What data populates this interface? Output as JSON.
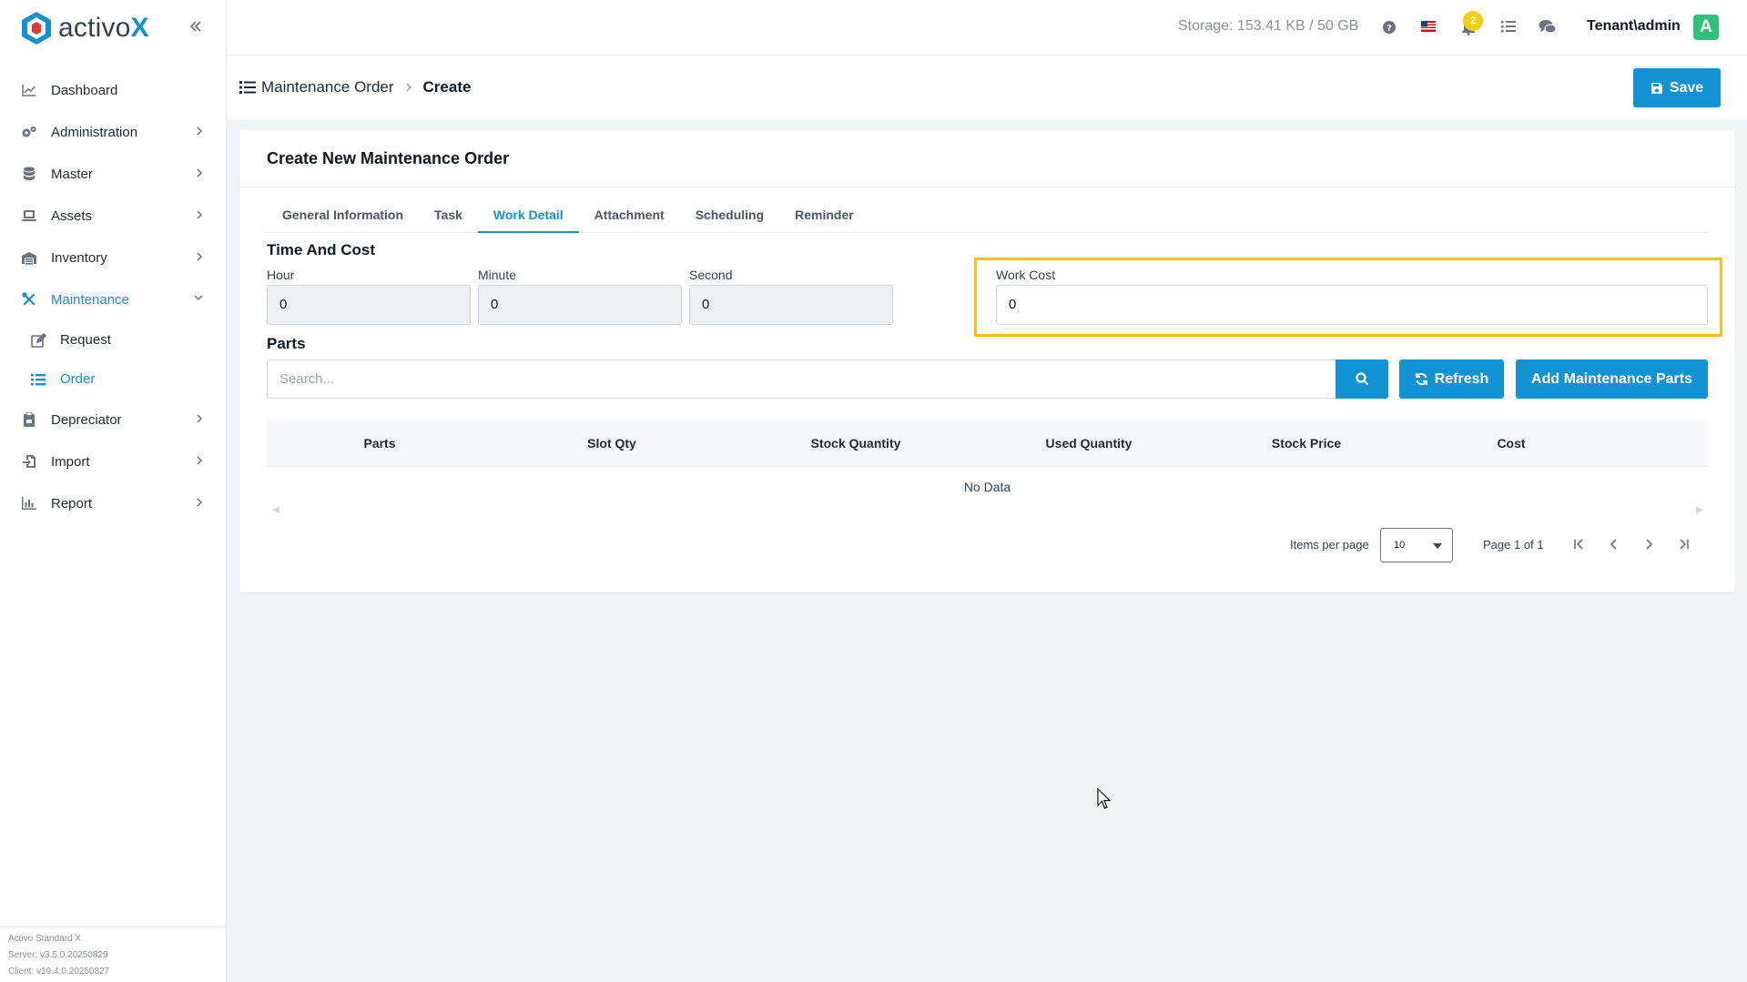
{
  "app": {
    "brand_prefix": "activo",
    "brand_suffix": "X"
  },
  "sidebar": {
    "items": [
      {
        "label": "Dashboard",
        "icon": "chart-line-icon"
      },
      {
        "label": "Administration",
        "icon": "gears-icon"
      },
      {
        "label": "Master",
        "icon": "database-icon"
      },
      {
        "label": "Assets",
        "icon": "laptop-icon"
      },
      {
        "label": "Inventory",
        "icon": "warehouse-icon"
      },
      {
        "label": "Maintenance",
        "icon": "tools-icon"
      },
      {
        "label": "Depreciator",
        "icon": "clipboard-icon"
      },
      {
        "label": "Import",
        "icon": "file-import-icon"
      },
      {
        "label": "Report",
        "icon": "chart-bar-icon"
      }
    ],
    "subitems": [
      {
        "label": "Request",
        "icon": "edit-icon"
      },
      {
        "label": "Order",
        "icon": "list-icon"
      }
    ],
    "footer": {
      "product": "Activo Standard X",
      "server": "Server: v3.5.0.20250829",
      "client": "Client: v19.4.0.20250827"
    }
  },
  "topbar": {
    "storage": "Storage: 153.41 KB / 50 GB",
    "notification_count": "2",
    "user": "Tenant\\admin",
    "avatar_letter": "A"
  },
  "header": {
    "breadcrumb_parent": "Maintenance Order",
    "breadcrumb_current": "Create",
    "save_label": "Save"
  },
  "card": {
    "title": "Create New Maintenance Order",
    "tabs": [
      "General Information",
      "Task",
      "Work Detail",
      "Attachment",
      "Scheduling",
      "Reminder"
    ],
    "active_tab": "Work Detail"
  },
  "time_cost": {
    "title": "Time And Cost",
    "hour_label": "Hour",
    "hour_value": "0",
    "minute_label": "Minute",
    "minute_value": "0",
    "second_label": "Second",
    "second_value": "0",
    "work_cost_label": "Work Cost",
    "work_cost_value": "0"
  },
  "parts": {
    "title": "Parts",
    "search_placeholder": "Search...",
    "refresh_label": "Refresh",
    "add_label": "Add Maintenance Parts",
    "columns": [
      "Parts",
      "Slot Qty",
      "Stock Quantity",
      "Used Quantity",
      "Stock Price",
      "Cost"
    ],
    "empty_text": "No Data"
  },
  "pagination": {
    "items_per_page_label": "Items per page",
    "items_per_page_value": "10",
    "page_text": "Page 1 of 1"
  },
  "colors": {
    "accent": "#1392d3",
    "highlight": "#f3c31b",
    "badge": "#facc15",
    "avatar": "#2ec27e"
  }
}
